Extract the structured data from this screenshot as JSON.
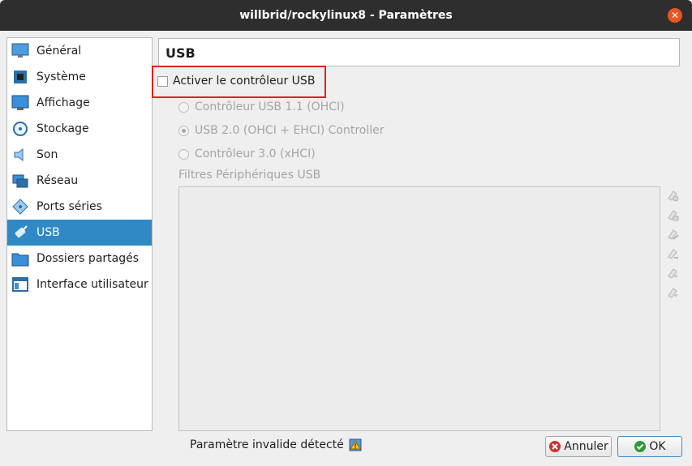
{
  "window": {
    "title": "willbrid/rockylinux8 - Paramètres"
  },
  "sidebar": {
    "items": [
      {
        "label": "Général",
        "icon": "general-icon"
      },
      {
        "label": "Système",
        "icon": "system-icon"
      },
      {
        "label": "Affichage",
        "icon": "display-icon"
      },
      {
        "label": "Stockage",
        "icon": "storage-icon"
      },
      {
        "label": "Son",
        "icon": "audio-icon"
      },
      {
        "label": "Réseau",
        "icon": "network-icon"
      },
      {
        "label": "Ports séries",
        "icon": "serial-ports-icon"
      },
      {
        "label": "USB",
        "icon": "usb-icon",
        "selected": true
      },
      {
        "label": "Dossiers partagés",
        "icon": "shared-folders-icon"
      },
      {
        "label": "Interface utilisateur",
        "icon": "user-interface-icon"
      }
    ]
  },
  "usb": {
    "header": "USB",
    "enable_label": "Activer le contrôleur USB",
    "enable_checked": false,
    "controllers": [
      {
        "label": "Contrôleur USB 1.1 (OHCI)",
        "checked": false
      },
      {
        "label": "USB 2.0 (OHCI + EHCI) Controller",
        "checked": true
      },
      {
        "label": "Contrôleur 3.0 (xHCI)",
        "checked": false
      }
    ],
    "filters_label": "Filtres Périphériques USB",
    "filter_tools": [
      "add-filter-icon",
      "add-from-device-icon",
      "edit-filter-icon",
      "remove-filter-icon",
      "move-up-icon",
      "move-down-icon"
    ]
  },
  "status": {
    "text": "Paramètre invalide détecté"
  },
  "buttons": {
    "cancel": "Annuler",
    "ok": "OK"
  },
  "colors": {
    "selection": "#3089c4",
    "highlight": "#e0201f",
    "titlebar": "#2e2e2e"
  }
}
